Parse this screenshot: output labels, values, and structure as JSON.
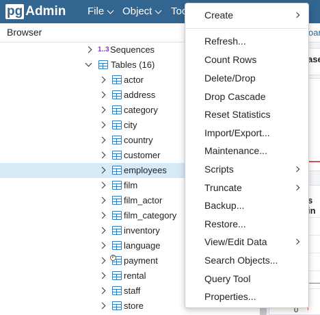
{
  "app": {
    "logo_pg": "pg",
    "logo_admin": "Admin"
  },
  "menubar": [
    {
      "label": "File"
    },
    {
      "label": "Object"
    },
    {
      "label": "Too"
    }
  ],
  "browser": {
    "title": "Browser"
  },
  "tree": {
    "sequences": {
      "badge": "1..3",
      "label": "Sequences"
    },
    "tables": {
      "label": "Tables (16)"
    },
    "items": [
      {
        "label": "actor"
      },
      {
        "label": "address"
      },
      {
        "label": "category"
      },
      {
        "label": "city"
      },
      {
        "label": "country"
      },
      {
        "label": "customer"
      },
      {
        "label": "employees"
      },
      {
        "label": "film"
      },
      {
        "label": "film_actor"
      },
      {
        "label": "film_category"
      },
      {
        "label": "inventory"
      },
      {
        "label": "language"
      },
      {
        "label": "payment"
      },
      {
        "label": "rental"
      },
      {
        "label": "staff"
      },
      {
        "label": "store"
      }
    ],
    "selected": "employees",
    "partition_badge": "P"
  },
  "background_peek": {
    "tab_fragment": "oar",
    "heading_fragment": "ase",
    "heading2_fragment": "s in",
    "axis_zero": "0"
  },
  "context_menu": {
    "items": [
      {
        "label": "Create",
        "submenu": true
      },
      {
        "label": "Refresh...",
        "submenu": false
      },
      {
        "label": "Count Rows",
        "submenu": false
      },
      {
        "label": "Delete/Drop",
        "submenu": false
      },
      {
        "label": "Drop Cascade",
        "submenu": false
      },
      {
        "label": "Reset Statistics",
        "submenu": false
      },
      {
        "label": "Import/Export...",
        "submenu": false
      },
      {
        "label": "Maintenance...",
        "submenu": false
      },
      {
        "label": "Scripts",
        "submenu": true
      },
      {
        "label": "Truncate",
        "submenu": true
      },
      {
        "label": "Backup...",
        "submenu": false
      },
      {
        "label": "Restore...",
        "submenu": false
      },
      {
        "label": "View/Edit Data",
        "submenu": true
      },
      {
        "label": "Search Objects...",
        "submenu": false
      },
      {
        "label": "Query Tool",
        "submenu": false
      },
      {
        "label": "Properties...",
        "submenu": false
      }
    ]
  },
  "colors": {
    "navbar": "#326690",
    "selection": "#d6eaf8",
    "table_icon": "#2f7bbf"
  }
}
